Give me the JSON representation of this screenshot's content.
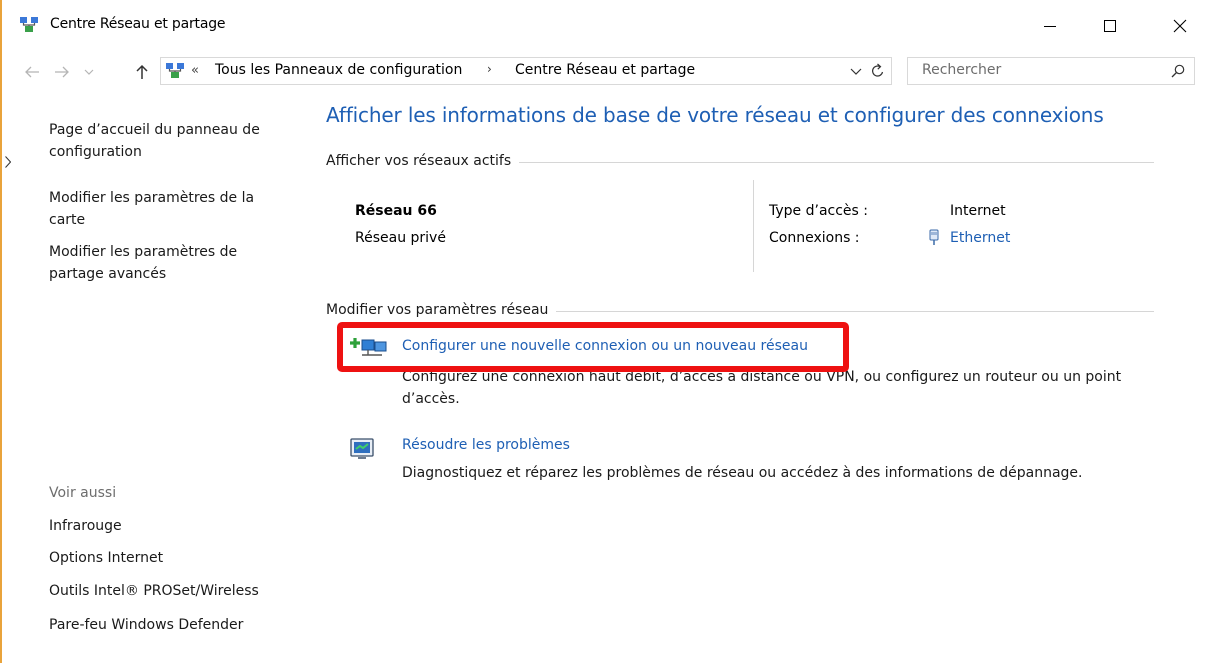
{
  "window": {
    "title": "Centre Réseau et partage",
    "controls": {
      "minimize": "minimize-icon",
      "maximize": "maximize-icon",
      "close": "close-icon"
    }
  },
  "address_bar": {
    "overflow": "«",
    "breadcrumbs": [
      "Tous les Panneaux de configuration",
      "Centre Réseau et partage"
    ],
    "separator": "›",
    "search_placeholder": "Rechercher"
  },
  "left_panel": {
    "tasks": [
      "Page d’accueil du panneau de configuration",
      "Modifier les paramètres de la carte",
      "Modifier les paramètres de partage avancés"
    ],
    "see_also_heading": "Voir aussi",
    "see_also": [
      "Infrarouge",
      "Options Internet",
      "Outils Intel® PROSet/Wireless",
      "Pare-feu Windows Defender"
    ]
  },
  "main": {
    "title": "Afficher les informations de base de votre réseau et configurer des connexions",
    "active_networks_heading": "Afficher vos réseaux actifs",
    "network": {
      "name": "Réseau  66",
      "category": "Réseau privé",
      "access_type_label": "Type d’accès :",
      "access_type_value": "Internet",
      "connections_label": "Connexions :",
      "connections_value": "Ethernet"
    },
    "change_settings_heading": "Modifier vos paramètres réseau",
    "tasks": [
      {
        "link": "Configurer une nouvelle connexion ou un nouveau réseau",
        "description": "Configurez une connexion haut débit, d’accès à distance ou VPN, ou configurez un routeur ou un point d’accès."
      },
      {
        "link": "Résoudre les problèmes",
        "description": "Diagnostiquez et réparez les problèmes de réseau ou accédez à des informations de dépannage."
      }
    ]
  },
  "colors": {
    "link": "#1e5fb4",
    "highlight": "#ee1111",
    "separator": "#d6d6d6",
    "muted": "#6d6d6d"
  }
}
